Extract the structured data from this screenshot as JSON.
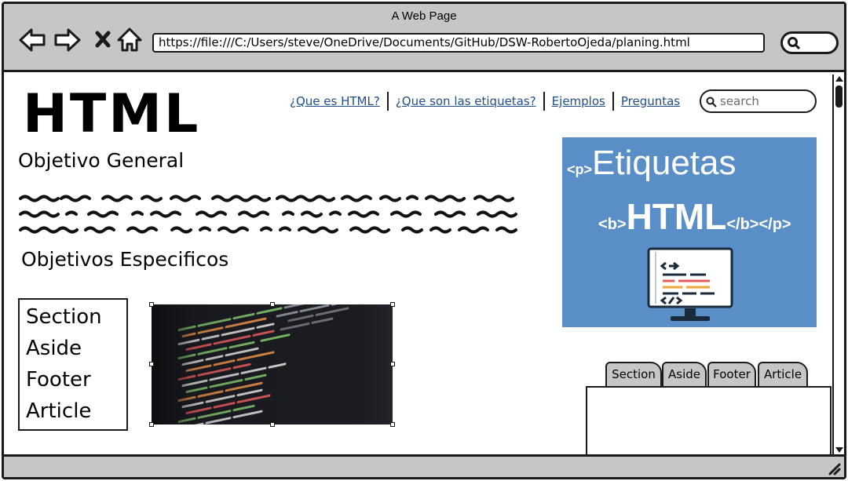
{
  "window": {
    "title": "A Web Page"
  },
  "browser": {
    "url": "https://file:///C:/Users/steve/OneDrive/Documents/GitHub/DSW-RobertoOjeda/planing.html",
    "nav_icons": [
      "back-icon",
      "forward-icon",
      "close-icon",
      "home-icon"
    ]
  },
  "header": {
    "logo": "HTML",
    "nav": [
      {
        "label": "¿Que es HTML?"
      },
      {
        "label": "¿Que son las etiquetas?"
      },
      {
        "label": "Ejemplos"
      },
      {
        "label": "Preguntas"
      }
    ],
    "search": {
      "placeholder": "search"
    }
  },
  "main": {
    "objetivo_general": "Objetivo General",
    "objetivos_especificos": "Objetivos Especificos",
    "list": [
      "Section",
      "Aside",
      "Footer",
      "Article"
    ]
  },
  "banner": {
    "tag_p": "<p>",
    "word_top": "Etiquetas",
    "tag_b": "<b>",
    "word_mid": "HTML",
    "tag_close": "</b></p>"
  },
  "tabs": [
    "Section",
    "Aside",
    "Footer",
    "Article"
  ],
  "colors": {
    "chrome": "#c6c6c6",
    "link": "#1f4e8c",
    "banner": "#5a8ec6"
  }
}
